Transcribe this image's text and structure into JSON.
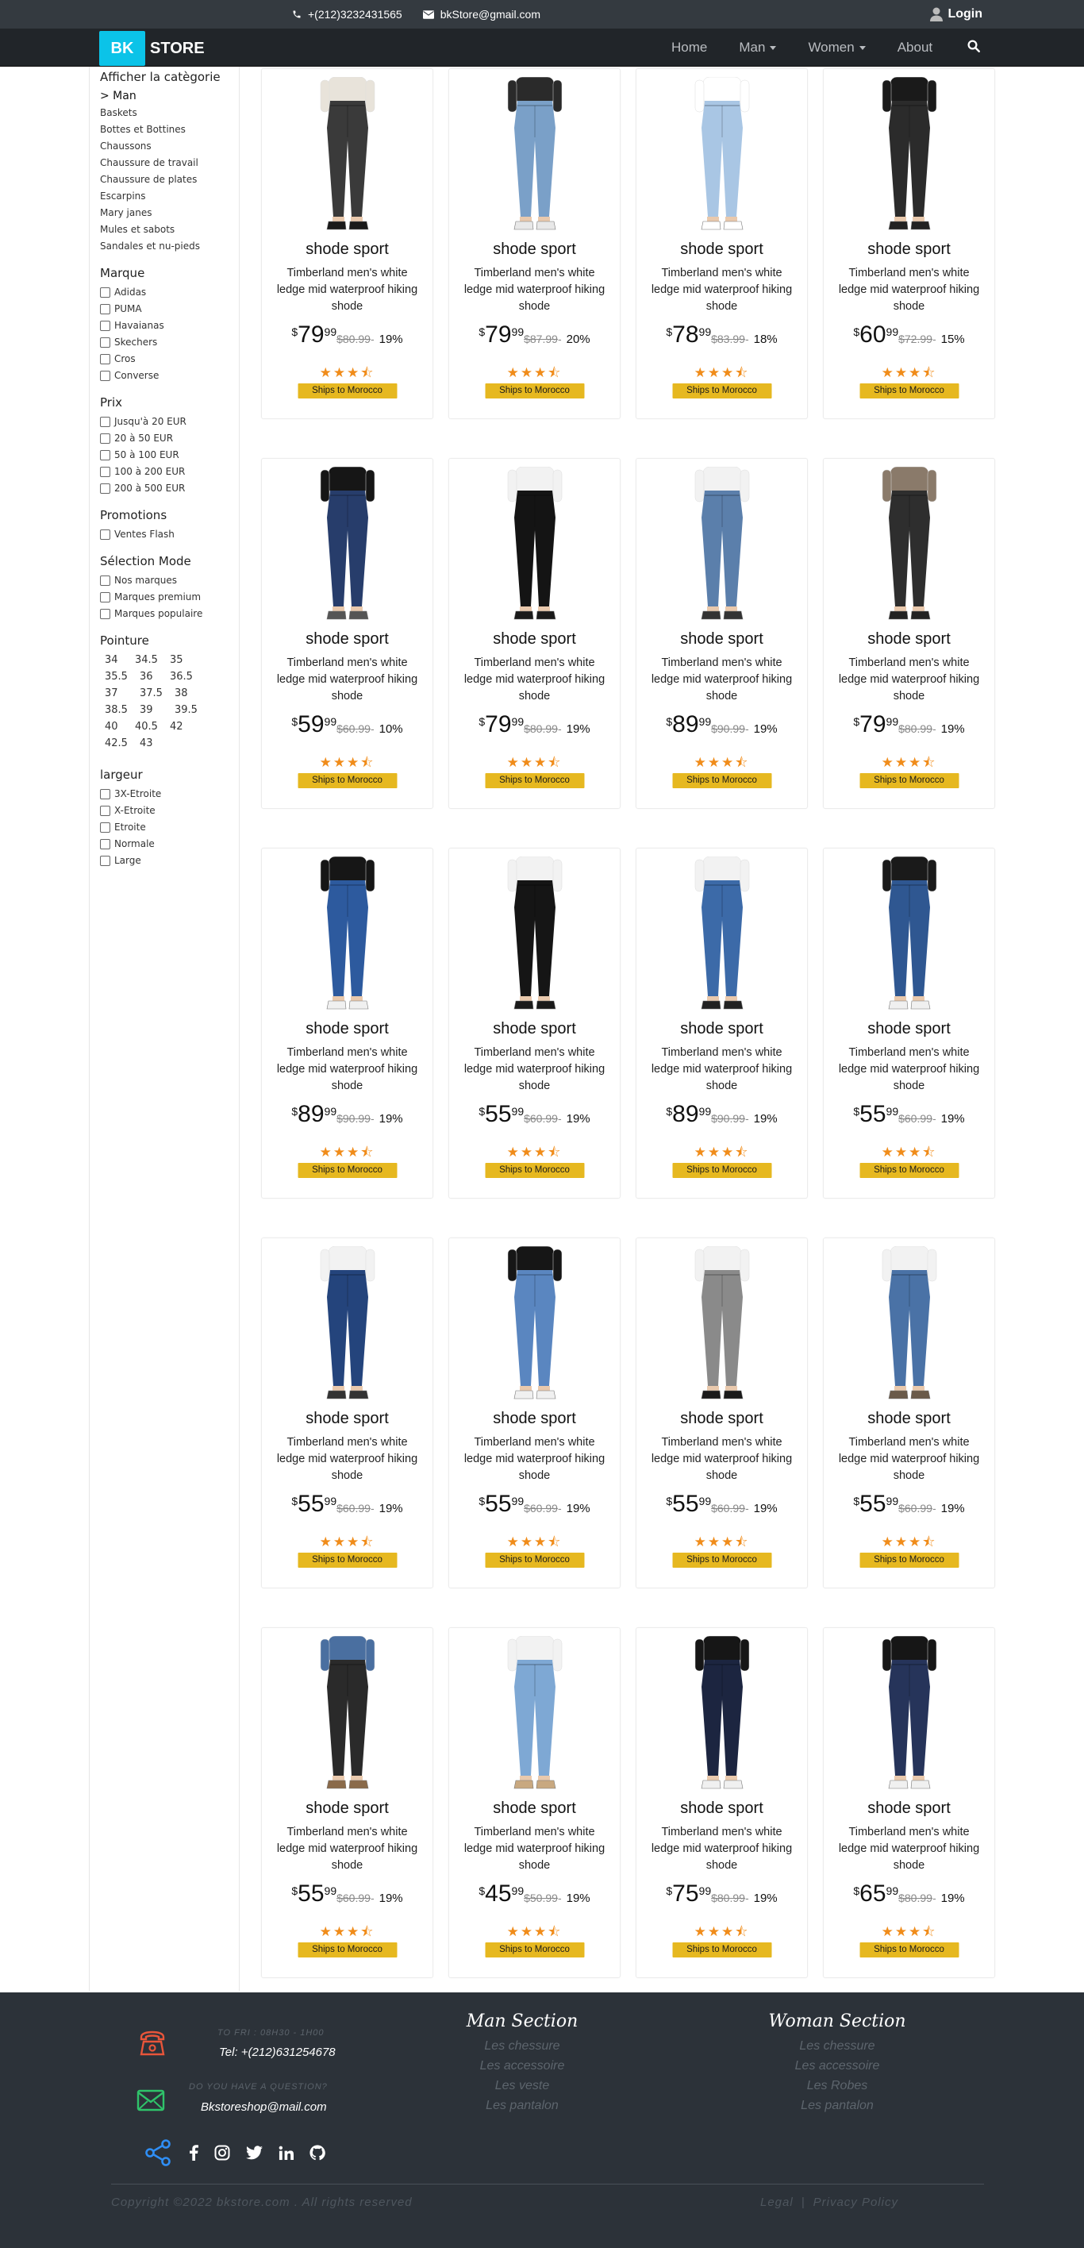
{
  "topbar": {
    "phone": "+(212)3232431565",
    "email": "bkStore@gmail.com",
    "login": "Login"
  },
  "brand": {
    "bk": "BK",
    "store": "STORE"
  },
  "nav": {
    "home": "Home",
    "man": "Man",
    "women": "Women",
    "about": "About"
  },
  "sidebar": {
    "category_title": "Afficher la catègorie",
    "category_active": "> Man",
    "categories": [
      "Baskets",
      "Bottes et Bottines",
      "Chaussons",
      "Chaussure de travail",
      "Chaussure de plates",
      "Escarpins",
      "Mary janes",
      "Mules et sabots",
      "Sandales et nu-pieds"
    ],
    "brand_title": "Marque",
    "brands": [
      "Adidas",
      "PUMA",
      "Havaianas",
      "Skechers",
      "Cros",
      "Converse"
    ],
    "price_title": "Prix",
    "prices": [
      "Jusqu'à 20 EUR",
      "20 à 50 EUR",
      "50 à 100 EUR",
      "100 à 200 EUR",
      "200 à 500 EUR"
    ],
    "promo_title": "Promotions",
    "promos": [
      "Ventes Flash"
    ],
    "mode_title": "Sélection Mode",
    "modes": [
      "Nos marques",
      "Marques premium",
      "Marques populaire"
    ],
    "size_title": "Pointure",
    "sizes": [
      "34",
      "34.5",
      "35",
      "35.5",
      "36",
      "36.5",
      "37",
      "37.5",
      "38",
      "38.5",
      "39",
      "39.5",
      "40",
      "40.5",
      "42",
      "42.5",
      "43"
    ],
    "width_title": "largeur",
    "widths": [
      "3X-Etroite",
      "X-Etroite",
      "Etroite",
      "Normale",
      "Large"
    ]
  },
  "colors": {
    "accent": "#0bc3e8",
    "star": "#f08c1a",
    "ship": "#e6b820",
    "footer_bg": "#2c3239"
  },
  "products": [
    {
      "name": "shode sport",
      "desc": "Timberland men's white ledge mid waterproof hiking shode",
      "currency": "$",
      "price_int": "79",
      "price_frac": "99",
      "old_price": "$80.99",
      "discount": "19%",
      "rating": 3.5,
      "ship": "Ships to Morocco",
      "jeans": "#3a3a3a",
      "top": "#e8e3da",
      "shoe": "#1a1a1a"
    },
    {
      "name": "shode sport",
      "desc": "Timberland men's white ledge mid waterproof hiking shode",
      "currency": "$",
      "price_int": "79",
      "price_frac": "99",
      "old_price": "$87.99",
      "discount": "20%",
      "rating": 3.5,
      "ship": "Ships to Morocco",
      "jeans": "#7aa0c8",
      "top": "#2a2a2a",
      "shoe": "#e8e8e8"
    },
    {
      "name": "shode sport",
      "desc": "Timberland men's white ledge mid waterproof hiking shode",
      "currency": "$",
      "price_int": "78",
      "price_frac": "99",
      "old_price": "$83.99",
      "discount": "18%",
      "rating": 3.5,
      "ship": "Ships to Morocco",
      "jeans": "#a9c6e4",
      "top": "#ffffff",
      "shoe": "#ffffff"
    },
    {
      "name": "shode sport",
      "desc": "Timberland men's white ledge mid waterproof hiking shode",
      "currency": "$",
      "price_int": "60",
      "price_frac": "99",
      "old_price": "$72.99",
      "discount": "15%",
      "rating": 3.5,
      "ship": "Ships to Morocco",
      "jeans": "#2b2b2b",
      "top": "#1a1a1a",
      "shoe": "#222222"
    },
    {
      "name": "shode sport",
      "desc": "Timberland men's white ledge mid waterproof hiking shode",
      "currency": "$",
      "price_int": "59",
      "price_frac": "99",
      "old_price": "$60.99",
      "discount": "10%",
      "rating": 3.5,
      "ship": "Ships to Morocco",
      "jeans": "#273d6b",
      "top": "#161616",
      "shoe": "#555555"
    },
    {
      "name": "shode sport",
      "desc": "Timberland men's white ledge mid waterproof hiking shode",
      "currency": "$",
      "price_int": "79",
      "price_frac": "99",
      "old_price": "$80.99",
      "discount": "19%",
      "rating": 3.5,
      "ship": "Ships to Morocco",
      "jeans": "#141414",
      "top": "#f2f2f2",
      "shoe": "#1a1a1a"
    },
    {
      "name": "shode sport",
      "desc": "Timberland men's white ledge mid waterproof hiking shode",
      "currency": "$",
      "price_int": "89",
      "price_frac": "99",
      "old_price": "$90.99",
      "discount": "19%",
      "rating": 3.5,
      "ship": "Ships to Morocco",
      "jeans": "#5b7fab",
      "top": "#f2f2f2",
      "shoe": "#333333"
    },
    {
      "name": "shode sport",
      "desc": "Timberland men's white ledge mid waterproof hiking shode",
      "currency": "$",
      "price_int": "79",
      "price_frac": "99",
      "old_price": "$80.99",
      "discount": "19%",
      "rating": 3.5,
      "ship": "Ships to Morocco",
      "jeans": "#2e2e2e",
      "top": "#8a7a6a",
      "shoe": "#222222"
    },
    {
      "name": "shode sport",
      "desc": "Timberland men's white ledge mid waterproof hiking shode",
      "currency": "$",
      "price_int": "89",
      "price_frac": "99",
      "old_price": "$90.99",
      "discount": "19%",
      "rating": 3.5,
      "ship": "Ships to Morocco",
      "jeans": "#2d5a9e",
      "top": "#161616",
      "shoe": "#f0f0f0"
    },
    {
      "name": "shode sport",
      "desc": "Timberland men's white ledge mid waterproof hiking shode",
      "currency": "$",
      "price_int": "55",
      "price_frac": "99",
      "old_price": "$60.99",
      "discount": "19%",
      "rating": 3.5,
      "ship": "Ships to Morocco",
      "jeans": "#151515",
      "top": "#f2f2f2",
      "shoe": "#1a1a1a"
    },
    {
      "name": "shode sport",
      "desc": "Timberland men's white ledge mid waterproof hiking shode",
      "currency": "$",
      "price_int": "89",
      "price_frac": "99",
      "old_price": "$90.99",
      "discount": "19%",
      "rating": 3.5,
      "ship": "Ships to Morocco",
      "jeans": "#3c6aa8",
      "top": "#f2f2f2",
      "shoe": "#222222"
    },
    {
      "name": "shode sport",
      "desc": "Timberland men's white ledge mid waterproof hiking shode",
      "currency": "$",
      "price_int": "55",
      "price_frac": "99",
      "old_price": "$60.99",
      "discount": "19%",
      "rating": 3.5,
      "ship": "Ships to Morocco",
      "jeans": "#2f5791",
      "top": "#1a1a1a",
      "shoe": "#f0f0f0"
    },
    {
      "name": "shode sport",
      "desc": "Timberland men's white ledge mid waterproof hiking shode",
      "currency": "$",
      "price_int": "55",
      "price_frac": "99",
      "old_price": "$60.99",
      "discount": "19%",
      "rating": 3.5,
      "ship": "Ships to Morocco",
      "jeans": "#24447c",
      "top": "#f2f2f2",
      "shoe": "#333333"
    },
    {
      "name": "shode sport",
      "desc": "Timberland men's white ledge mid waterproof hiking shode",
      "currency": "$",
      "price_int": "55",
      "price_frac": "99",
      "old_price": "$60.99",
      "discount": "19%",
      "rating": 3.5,
      "ship": "Ships to Morocco",
      "jeans": "#5a86c0",
      "top": "#161616",
      "shoe": "#f0f0f0"
    },
    {
      "name": "shode sport",
      "desc": "Timberland men's white ledge mid waterproof hiking shode",
      "currency": "$",
      "price_int": "55",
      "price_frac": "99",
      "old_price": "$60.99",
      "discount": "19%",
      "rating": 3.5,
      "ship": "Ships to Morocco",
      "jeans": "#8a8a8a",
      "top": "#f2f2f2",
      "shoe": "#1a1a1a"
    },
    {
      "name": "shode sport",
      "desc": "Timberland men's white ledge mid waterproof hiking shode",
      "currency": "$",
      "price_int": "55",
      "price_frac": "99",
      "old_price": "$60.99",
      "discount": "19%",
      "rating": 3.5,
      "ship": "Ships to Morocco",
      "jeans": "#4a72a6",
      "top": "#f2f2f2",
      "shoe": "#6a5a4a"
    },
    {
      "name": "shode sport",
      "desc": "Timberland men's white ledge mid waterproof hiking shode",
      "currency": "$",
      "price_int": "55",
      "price_frac": "99",
      "old_price": "$60.99",
      "discount": "19%",
      "rating": 3.5,
      "ship": "Ships to Morocco",
      "jeans": "#2a2a2a",
      "top": "#4a6fa0",
      "shoe": "#8a6a4a"
    },
    {
      "name": "shode sport",
      "desc": "Timberland men's white ledge mid waterproof hiking shode",
      "currency": "$",
      "price_int": "45",
      "price_frac": "99",
      "old_price": "$50.99",
      "discount": "19%",
      "rating": 3.5,
      "ship": "Ships to Morocco",
      "jeans": "#7ea8d4",
      "top": "#f2f2f2",
      "shoe": "#c8a880"
    },
    {
      "name": "shode sport",
      "desc": "Timberland men's white ledge mid waterproof hiking shode",
      "currency": "$",
      "price_int": "75",
      "price_frac": "99",
      "old_price": "$80.99",
      "discount": "19%",
      "rating": 3.5,
      "ship": "Ships to Morocco",
      "jeans": "#1c2540",
      "top": "#161616",
      "shoe": "#f0f0f0"
    },
    {
      "name": "shode sport",
      "desc": "Timberland men's white ledge mid waterproof hiking shode",
      "currency": "$",
      "price_int": "65",
      "price_frac": "99",
      "old_price": "$80.99",
      "discount": "19%",
      "rating": 3.5,
      "ship": "Ships to Morocco",
      "jeans": "#26345a",
      "top": "#161616",
      "shoe": "#f0f0f0"
    }
  ],
  "footer": {
    "hours": "TO FRI : 08H30 - 1H00",
    "tel": "Tel: +(212)631254678",
    "question": "DO YOU HAVE A QUESTION?",
    "email": "Bkstoreshop@mail.com",
    "man_title": "Man Section",
    "man_links": [
      "Les chessure",
      "Les accessoire",
      "Les veste",
      "Les pantalon"
    ],
    "woman_title": "Woman Section",
    "woman_links": [
      "Les chessure",
      "Les accessoire",
      "Les Robes",
      "Les pantalon"
    ],
    "copyright": "Copyright ©2022 bkstore.com . All rights reserved",
    "legal": "Legal",
    "separator": "|",
    "privacy": "Privacy Policy"
  }
}
